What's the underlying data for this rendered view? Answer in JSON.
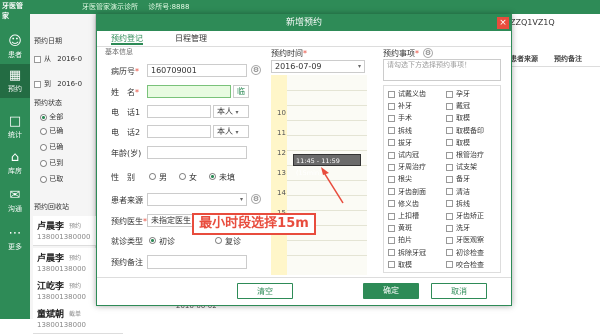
{
  "app": {
    "logo": "牙医管家",
    "sub": "牙医管家演示诊所",
    "topbar_code": "诊所号:8888",
    "right_code": "ZZQ1VZ1Q"
  },
  "nav": [
    {
      "icon": "user-icon",
      "label": "患者"
    },
    {
      "icon": "calendar-icon",
      "label": "预约"
    },
    {
      "icon": "chart-icon",
      "label": "统计"
    },
    {
      "icon": "box-icon",
      "label": "库房"
    },
    {
      "icon": "chat-icon",
      "label": "沟通"
    },
    {
      "icon": "more-icon",
      "label": "更多"
    }
  ],
  "left": {
    "date_label": "预约日期",
    "from_label": "从",
    "from_date": "2016-0",
    "to_label": "到",
    "to_date": "2016-0",
    "status_label": "预约状态",
    "status_options": [
      "全部",
      "已确",
      "已确",
      "已到",
      "已取"
    ],
    "recycle_label": "预约回收站",
    "cards": [
      {
        "name": "卢晨李",
        "tag": "预约",
        "phone": "138001380000"
      },
      {
        "name": "卢晨李",
        "tag": "预约",
        "phone": "13800138000"
      },
      {
        "name": "江屹李",
        "tag": "预约",
        "phone": "13800138000"
      },
      {
        "name": "童斌朝",
        "tag": "截单",
        "phone": "13800138000"
      }
    ]
  },
  "bg": {
    "col_source": "患者来源",
    "col_note": "预约备注",
    "bottom_date": "2016-06-02"
  },
  "dialog": {
    "title": "新增预约",
    "close": "×",
    "tabs": [
      "预约登记",
      "日程管理"
    ],
    "section": "基本信息",
    "fields": {
      "record_label": "病历号",
      "record_value": "160709001",
      "name_label": "姓　名",
      "name_btn": "临",
      "phone1_label": "电　话1",
      "phone1_owner": "本人",
      "phone2_label": "电　话2",
      "phone2_owner": "本人",
      "age_label": "年龄(岁)",
      "gender_label": "性　别",
      "gender_options": [
        "男",
        "女",
        "未填"
      ],
      "source_label": "患者来源",
      "doctor_label": "预约医生",
      "doctor_value": "未指定医生",
      "visit_label": "就诊类型",
      "visit_options": [
        "初诊",
        "复诊"
      ],
      "note_label": "预约备注"
    },
    "time": {
      "label": "预约时间",
      "date": "2016-07-09",
      "hours": [
        "10",
        "11",
        "12",
        "13",
        "14",
        "15",
        "16"
      ],
      "slot": "11:45 - 11:59 (15min)"
    },
    "items": {
      "label": "预约事项",
      "placeholder": "请勾选下方选择预约事项！",
      "list": [
        "试戴义齿",
        "孕牙",
        "补牙",
        "戴冠",
        "手术",
        "取模",
        "拆线",
        "取模备印",
        "拔牙",
        "取模",
        "试内冠",
        "根管治疗",
        "牙周治疗",
        "试支架",
        "根尖",
        "备牙",
        "牙齿剖面",
        "清洁",
        "修义齿",
        "拆线",
        "上扣槽",
        "牙齿矫正",
        "黄斑",
        "洗牙",
        "拍片",
        "牙医观察",
        "拆除牙冠",
        "初诊检查",
        "取模",
        "咬合检查"
      ]
    },
    "buttons": {
      "clear": "清空",
      "ok": "确定",
      "cancel": "取消"
    }
  },
  "annotation": "最小时段选择15m"
}
